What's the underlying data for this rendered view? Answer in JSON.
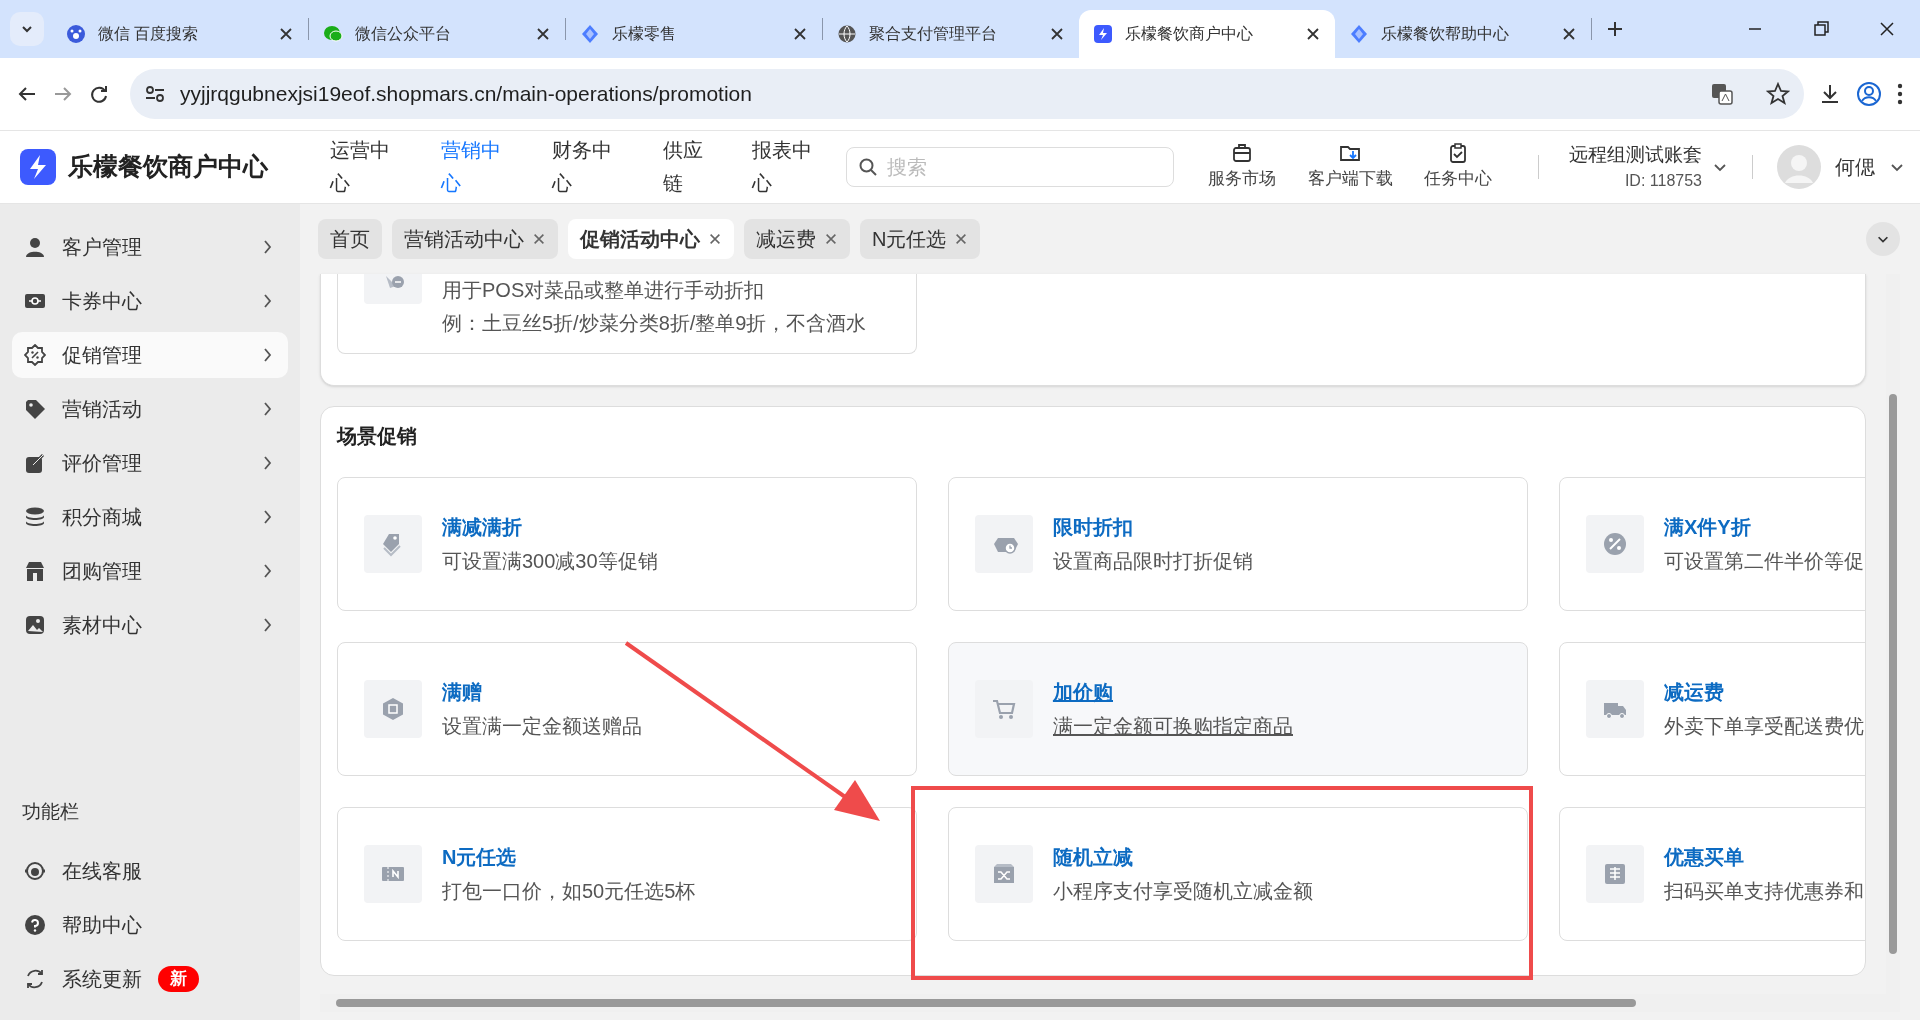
{
  "browser": {
    "tabs": [
      {
        "title": "微信 百度搜索",
        "selected": false
      },
      {
        "title": "微信公众平台",
        "selected": false
      },
      {
        "title": "乐檬零售",
        "selected": false
      },
      {
        "title": "聚合支付管理平台",
        "selected": false
      },
      {
        "title": "乐檬餐饮商户中心",
        "selected": true
      },
      {
        "title": "乐檬餐饮帮助中心",
        "selected": false
      }
    ],
    "url": "yyjjrqgubnexjsi19eof.shopmars.cn/main-operations/promotion"
  },
  "app": {
    "name": "乐檬餐饮商户中心",
    "nav": [
      {
        "label": "运营中心",
        "selected": false
      },
      {
        "label": "营销中心",
        "selected": true
      },
      {
        "label": "财务中心",
        "selected": false
      },
      {
        "label": "供应链",
        "selected": false
      },
      {
        "label": "报表中心",
        "selected": false
      }
    ],
    "search": {
      "placeholder": "搜索"
    },
    "tools": [
      {
        "label": "服务市场"
      },
      {
        "label": "客户端下载"
      },
      {
        "label": "任务中心"
      }
    ],
    "account": {
      "name": "远程组测试账套",
      "id": "ID: 118753"
    },
    "user": {
      "name": "何偲"
    }
  },
  "sidebar": {
    "items": [
      {
        "label": "客户管理",
        "selected": false
      },
      {
        "label": "卡券中心",
        "selected": false
      },
      {
        "label": "促销管理",
        "selected": true
      },
      {
        "label": "营销活动",
        "selected": false
      },
      {
        "label": "评价管理",
        "selected": false
      },
      {
        "label": "积分商城",
        "selected": false
      },
      {
        "label": "团购管理",
        "selected": false
      },
      {
        "label": "素材中心",
        "selected": false
      }
    ],
    "section_label": "功能栏",
    "tools": [
      {
        "label": "在线客服"
      },
      {
        "label": "帮助中心"
      },
      {
        "label": "系统更新",
        "badge": "新"
      }
    ]
  },
  "page_tabs": [
    {
      "label": "首页",
      "closable": false,
      "selected": false
    },
    {
      "label": "营销活动中心",
      "closable": true,
      "selected": false
    },
    {
      "label": "促销活动中心",
      "closable": true,
      "selected": true
    },
    {
      "label": "减运费",
      "closable": true,
      "selected": false
    },
    {
      "label": "N元任选",
      "closable": true,
      "selected": false
    }
  ],
  "top_card": {
    "lines": [
      "用于POS对菜品或整单进行手动折扣",
      "例：土豆丝5折/炒菜分类8折/整单9折，不含酒水"
    ]
  },
  "section": {
    "title": "场景促销",
    "cards": [
      {
        "title": "满减满折",
        "desc": "可设置满300减30等促销",
        "hovered": false
      },
      {
        "title": "限时折扣",
        "desc": "设置商品限时打折促销",
        "hovered": false
      },
      {
        "title": "满X件Y折",
        "desc": "可设置第二件半价等促",
        "hovered": false
      },
      {
        "title": "满赠",
        "desc": "设置满一定金额送赠品",
        "hovered": false
      },
      {
        "title": "加价购",
        "desc": "满一定金额可换购指定商品",
        "hovered": true
      },
      {
        "title": "减运费",
        "desc": "外卖下单享受配送费优",
        "hovered": false
      },
      {
        "title": "N元任选",
        "desc": "打包一口价，如50元任选5杯",
        "hovered": false
      },
      {
        "title": "随机立减",
        "desc": "小程序支付享受随机立减金额",
        "hovered": false
      },
      {
        "title": "优惠买单",
        "desc": "扫码买单支持优惠券和",
        "hovered": false
      }
    ]
  }
}
